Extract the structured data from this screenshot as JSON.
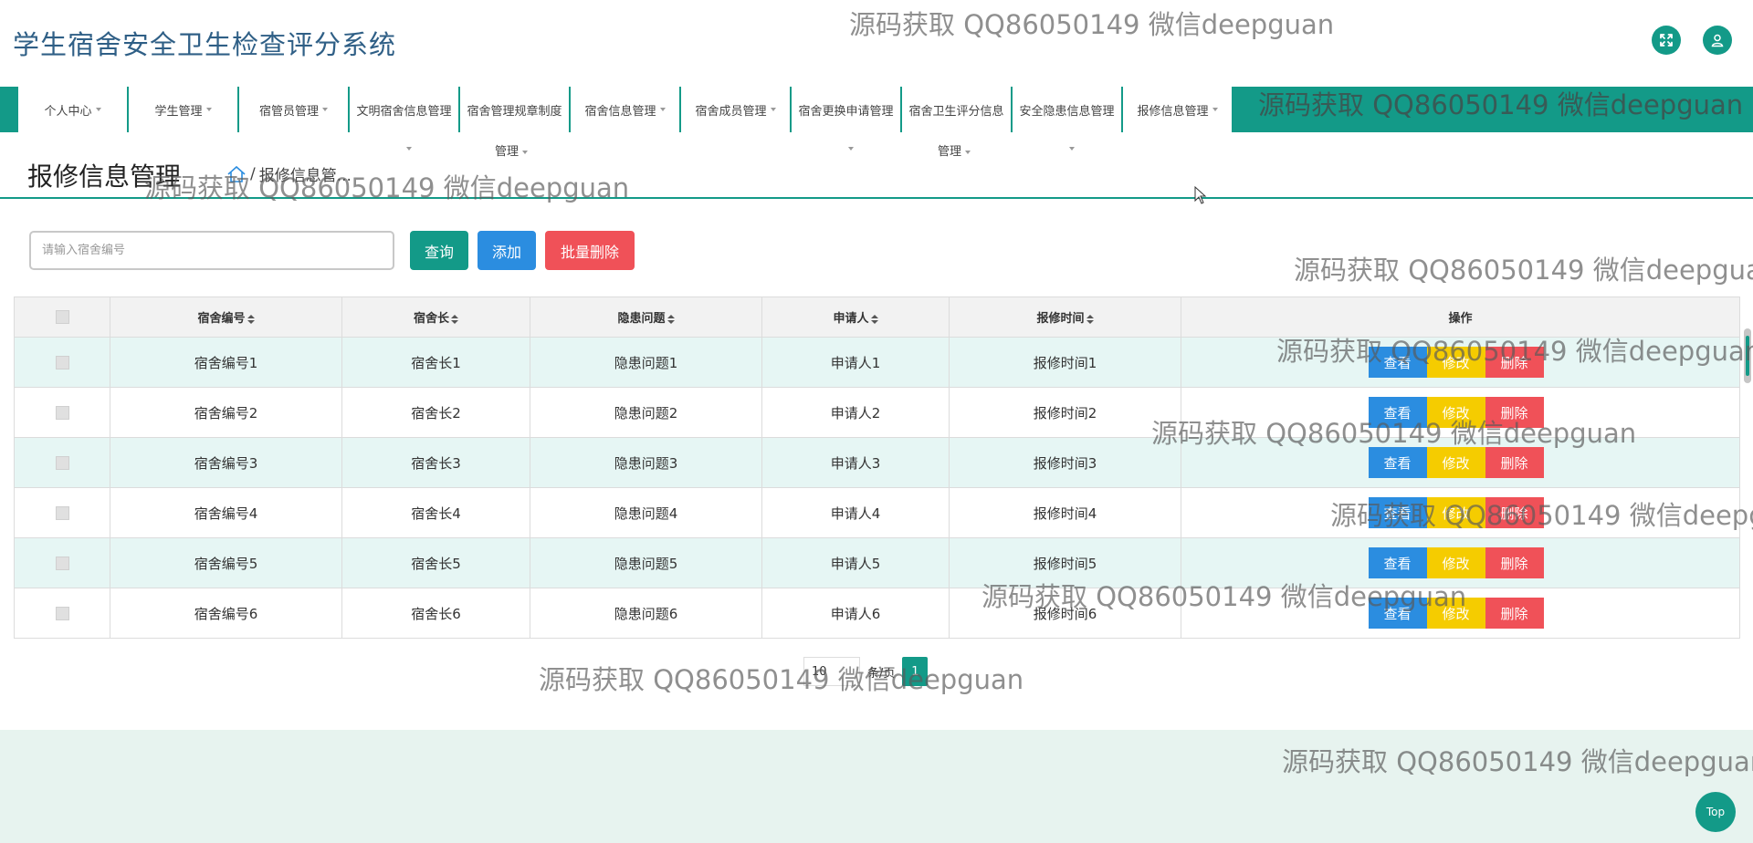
{
  "app_title": "学生宿舍安全卫生检查评分系统",
  "header_buttons": [
    {
      "icon": "fullscreen-icon"
    },
    {
      "icon": "user-icon"
    }
  ],
  "nav": {
    "items": [
      {
        "label": "个人中心"
      },
      {
        "label": "学生管理"
      },
      {
        "label": "宿管员管理"
      },
      {
        "label": "文明宿舍信息管理"
      },
      {
        "label": "宿舍管理规章制度",
        "sub": "管理"
      },
      {
        "label": "宿舍信息管理"
      },
      {
        "label": "宿舍成员管理"
      },
      {
        "label": "宿舍更换申请管理"
      },
      {
        "label": "宿舍卫生评分信息",
        "sub": "管理"
      },
      {
        "label": "安全隐患信息管理"
      },
      {
        "label": "报修信息管理"
      }
    ]
  },
  "breadcrumb": {
    "title": "报修信息管理",
    "separator": "/",
    "current": "报修信息管..."
  },
  "toolbar": {
    "search_placeholder": "请输入宿舍编号",
    "query_label": "查询",
    "add_label": "添加",
    "batch_delete_label": "批量删除"
  },
  "table": {
    "columns": [
      "宿舍编号",
      "宿舍长",
      "隐患问题",
      "申请人",
      "报修时间",
      "操作"
    ],
    "rows": [
      [
        "宿舍编号1",
        "宿舍长1",
        "隐患问题1",
        "申请人1",
        "报修时间1"
      ],
      [
        "宿舍编号2",
        "宿舍长2",
        "隐患问题2",
        "申请人2",
        "报修时间2"
      ],
      [
        "宿舍编号3",
        "宿舍长3",
        "隐患问题3",
        "申请人3",
        "报修时间3"
      ],
      [
        "宿舍编号4",
        "宿舍长4",
        "隐患问题4",
        "申请人4",
        "报修时间4"
      ],
      [
        "宿舍编号5",
        "宿舍长5",
        "隐患问题5",
        "申请人5",
        "报修时间5"
      ],
      [
        "宿舍编号6",
        "宿舍长6",
        "隐患问题6",
        "申请人6",
        "报修时间6"
      ]
    ],
    "actions": {
      "view": "查看",
      "edit": "修改",
      "delete": "删除"
    }
  },
  "pagination": {
    "page_size": "10",
    "unit": "条/页",
    "current_page": "1"
  },
  "top_button": "Top",
  "watermark": "源码获取 QQ86050149 微信deepguan",
  "colors": {
    "primary": "#139a88",
    "title": "#2f5f86",
    "view": "#2b8de0",
    "edit": "#f5cc00",
    "delete": "#f05158",
    "row_alt": "#e6f6f4",
    "footer": "#e7f3ef"
  }
}
